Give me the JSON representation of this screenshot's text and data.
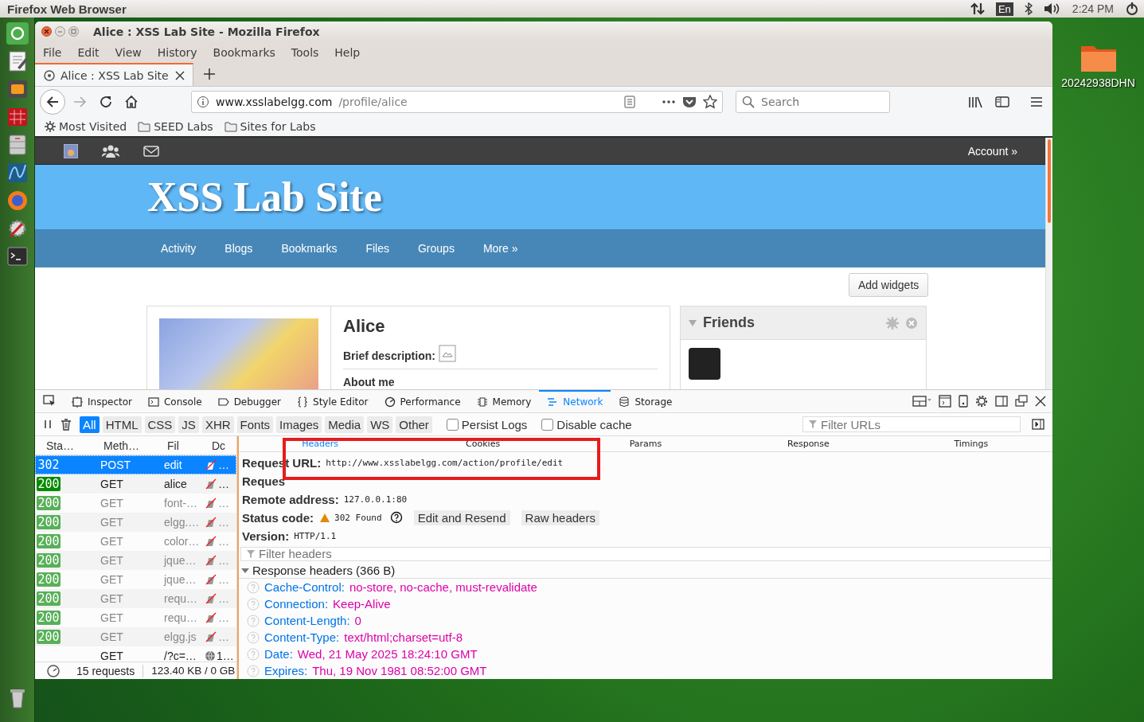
{
  "top_panel": {
    "title": "Firefox Web Browser",
    "keyboard": "En",
    "clock": "2:24 PM"
  },
  "desktop_icons": [
    {
      "label": "20242938DHN"
    }
  ],
  "window": {
    "title": "Alice : XSS Lab Site - Mozilla Firefox"
  },
  "menu": [
    "File",
    "Edit",
    "View",
    "History",
    "Bookmarks",
    "Tools",
    "Help"
  ],
  "tabs": [
    {
      "label": "Alice : XSS Lab Site",
      "selected": true
    }
  ],
  "address_bar": {
    "host": "www.xsslabelgg.com",
    "path": "/profile/alice"
  },
  "search": {
    "placeholder": "Search"
  },
  "bookmarks": [
    {
      "label": "Most Visited",
      "kind": "smart"
    },
    {
      "label": "SEED Labs",
      "kind": "folder"
    },
    {
      "label": "Sites for Labs",
      "kind": "folder"
    }
  ],
  "site": {
    "account": "Account »",
    "title": "XSS Lab Site",
    "nav": [
      "Activity",
      "Blogs",
      "Bookmarks",
      "Files",
      "Groups",
      "More »"
    ],
    "add_widgets": "Add widgets",
    "profile": {
      "name": "Alice",
      "brief_label": "Brief description:",
      "about_label": "About me"
    },
    "friends": {
      "title": "Friends"
    }
  },
  "devtools": {
    "tools": [
      {
        "label": "Inspector",
        "selected": false
      },
      {
        "label": "Console",
        "selected": false
      },
      {
        "label": "Debugger",
        "selected": false
      },
      {
        "label": "Style Editor",
        "selected": false
      },
      {
        "label": "Performance",
        "selected": false
      },
      {
        "label": "Memory",
        "selected": false
      },
      {
        "label": "Network",
        "selected": true
      },
      {
        "label": "Storage",
        "selected": false
      }
    ],
    "filters": [
      {
        "label": "All",
        "selected": true
      },
      {
        "label": "HTML",
        "selected": false
      },
      {
        "label": "CSS",
        "selected": false
      },
      {
        "label": "JS",
        "selected": false
      },
      {
        "label": "XHR",
        "selected": false
      },
      {
        "label": "Fonts",
        "selected": false
      },
      {
        "label": "Images",
        "selected": false
      },
      {
        "label": "Media",
        "selected": false
      },
      {
        "label": "WS",
        "selected": false
      },
      {
        "label": "Other",
        "selected": false
      }
    ],
    "persist_logs": {
      "label": "Persist Logs",
      "checked": false
    },
    "disable_cache": {
      "label": "Disable cache",
      "checked": false
    },
    "filter_urls": {
      "placeholder": "Filter URLs"
    },
    "columns": [
      "Sta…",
      "Meth…",
      "Fil",
      "Dc"
    ],
    "requests": [
      {
        "status": "302",
        "method": "POST",
        "file": "edit",
        "transferred": "…",
        "kind": "cached",
        "selected": true,
        "dimmed": false
      },
      {
        "status": "200",
        "method": "GET",
        "file": "alice",
        "transferred": "…",
        "kind": "cached",
        "selected": false,
        "dimmed": false
      },
      {
        "status": "200",
        "method": "GET",
        "file": "font-…",
        "transferred": "…",
        "kind": "cached",
        "selected": false,
        "dimmed": true
      },
      {
        "status": "200",
        "method": "GET",
        "file": "elgg.…",
        "transferred": "…",
        "kind": "cached",
        "selected": false,
        "dimmed": true
      },
      {
        "status": "200",
        "method": "GET",
        "file": "color…",
        "transferred": "…",
        "kind": "cached",
        "selected": false,
        "dimmed": true
      },
      {
        "status": "200",
        "method": "GET",
        "file": "jque…",
        "transferred": "…",
        "kind": "cached",
        "selected": false,
        "dimmed": true
      },
      {
        "status": "200",
        "method": "GET",
        "file": "jque…",
        "transferred": "…",
        "kind": "cached",
        "selected": false,
        "dimmed": true
      },
      {
        "status": "200",
        "method": "GET",
        "file": "requ…",
        "transferred": "…",
        "kind": "cached",
        "selected": false,
        "dimmed": true
      },
      {
        "status": "200",
        "method": "GET",
        "file": "requ…",
        "transferred": "…",
        "kind": "cached",
        "selected": false,
        "dimmed": true
      },
      {
        "status": "200",
        "method": "GET",
        "file": "elgg.js",
        "transferred": "…",
        "kind": "cached",
        "selected": false,
        "dimmed": true
      },
      {
        "method": "GET",
        "file": "/?c=…",
        "transferred": "1…",
        "kind": "network",
        "selected": false,
        "dimmed": false
      }
    ],
    "status_bar": {
      "requests": "15 requests",
      "size": "123.40 KB / 0 GB"
    },
    "detail_tabs": [
      {
        "label": "Headers",
        "selected": true
      },
      {
        "label": "Cookies",
        "selected": false
      },
      {
        "label": "Params",
        "selected": false
      },
      {
        "label": "Response",
        "selected": false
      },
      {
        "label": "Timings",
        "selected": false
      }
    ],
    "summary": [
      {
        "label": "Request URL:",
        "value": "http://www.xsslabelgg.com/action/profile/edit"
      },
      {
        "label": "Reques"
      },
      {
        "label": "Remote address:",
        "value": "127.0.0.1:80"
      },
      {
        "label": "Status code:",
        "value": "302 Found",
        "kind": "status"
      },
      {
        "label": "Version:",
        "value": "HTTP/1.1"
      }
    ],
    "edit_resend": "Edit and Resend",
    "raw_headers": "Raw headers",
    "filter_headers": {
      "placeholder": "Filter headers"
    },
    "response_headers": {
      "title": "Response headers (366 B)",
      "expanded": true,
      "headers": [
        {
          "name": "Cache-Control:",
          "value": "no-store, no-cache, must-revalidate"
        },
        {
          "name": "Connection:",
          "value": "Keep-Alive"
        },
        {
          "name": "Content-Length:",
          "value": "0"
        },
        {
          "name": "Content-Type:",
          "value": "text/html;charset=utf-8"
        },
        {
          "name": "Date:",
          "value": "Wed, 21 May 2025 18:24:10 GMT"
        },
        {
          "name": "Expires:",
          "value": "Thu, 19 Nov 1981 08:52:00 GMT"
        }
      ]
    }
  }
}
